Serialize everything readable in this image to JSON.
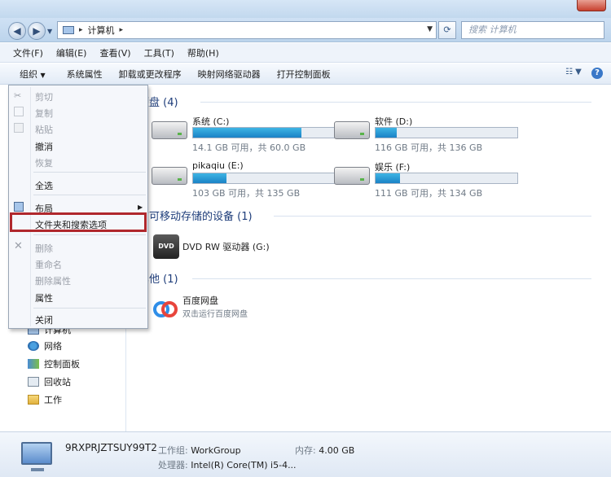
{
  "address": {
    "path": "计算机",
    "search_placeholder": "搜索 计算机"
  },
  "menubar": [
    "文件(F)",
    "编辑(E)",
    "查看(V)",
    "工具(T)",
    "帮助(H)"
  ],
  "toolbar": {
    "organize": "组织",
    "items": [
      "系统属性",
      "卸载或更改程序",
      "映射网络驱动器",
      "打开控制面板"
    ]
  },
  "context_menu": {
    "cut": "剪切",
    "copy": "复制",
    "paste": "粘贴",
    "undo": "撤消",
    "redo": "恢复",
    "select_all": "全选",
    "layout": "布局",
    "folder_options": "文件夹和搜索选项",
    "delete": "删除",
    "rename": "重命名",
    "remove_properties": "删除属性",
    "properties": "属性",
    "close": "关闭"
  },
  "nav": {
    "computer": "计算机",
    "network": "网络",
    "control_panel": "控制面板",
    "recycle_bin": "回收站",
    "work": "工作"
  },
  "groups": {
    "hard_disks": "硬盘 (4)",
    "removable": "有可移动存储的设备 (1)",
    "other": "其他 (1)"
  },
  "drives": [
    {
      "name": "系统 (C:)",
      "info": "14.1 GB 可用，共 60.0 GB",
      "used_fraction": 0.765
    },
    {
      "name": "软件 (D:)",
      "info": "116 GB 可用，共 136 GB",
      "used_fraction": 0.147
    },
    {
      "name": "pikaqiu (E:)",
      "info": "103 GB 可用，共 135 GB",
      "used_fraction": 0.237
    },
    {
      "name": "娱乐 (F:)",
      "info": "111 GB 可用，共 134 GB",
      "used_fraction": 0.172
    }
  ],
  "dvd": {
    "icon_text": "DVD",
    "name": "DVD RW 驱动器 (G:)"
  },
  "baidu": {
    "name": "百度网盘",
    "subtitle": "双击运行百度网盘"
  },
  "status": {
    "computer_name": "9RXPRJZTSUY99T2",
    "workgroup_label": "工作组:",
    "workgroup": "WorkGroup",
    "memory_label": "内存:",
    "memory": "4.00 GB",
    "processor_label": "处理器:",
    "processor": "Intel(R) Core(TM) i5-4..."
  },
  "colors": {
    "accent": "#1b83c6",
    "highlight_box": "#b0272c"
  }
}
